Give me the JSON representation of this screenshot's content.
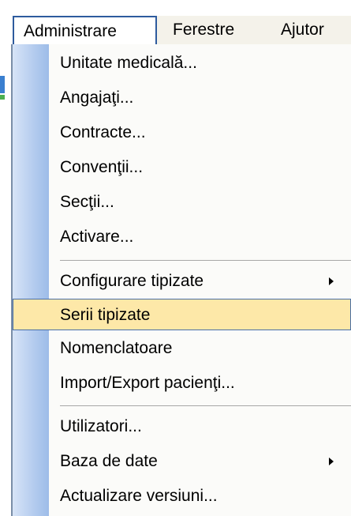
{
  "menubar": {
    "items": [
      {
        "label": "Administrare",
        "active": true
      },
      {
        "label": "Ferestre",
        "active": false
      },
      {
        "label": "Ajutor",
        "active": false
      }
    ]
  },
  "dropdown": {
    "groups": [
      [
        {
          "label": "Unitate medicală..."
        },
        {
          "label": "Angajaţi..."
        },
        {
          "label": "Contracte..."
        },
        {
          "label": "Convenţii..."
        },
        {
          "label": "Secţii..."
        },
        {
          "label": "Activare..."
        }
      ],
      [
        {
          "label": "Configurare tipizate",
          "submenu": true
        },
        {
          "label": "Serii tipizate",
          "highlighted": true
        },
        {
          "label": "Nomenclatoare"
        },
        {
          "label": "Import/Export pacienţi..."
        }
      ],
      [
        {
          "label": "Utilizatori..."
        },
        {
          "label": "Baza de date",
          "submenu": true
        },
        {
          "label": "Actualizare versiuni..."
        }
      ]
    ]
  },
  "colors": {
    "highlight_bg": "#fde8a8",
    "highlight_border": "#4a6fa6",
    "gutter": "#b6cdef",
    "menubar_bg": "#f4f2ea"
  }
}
